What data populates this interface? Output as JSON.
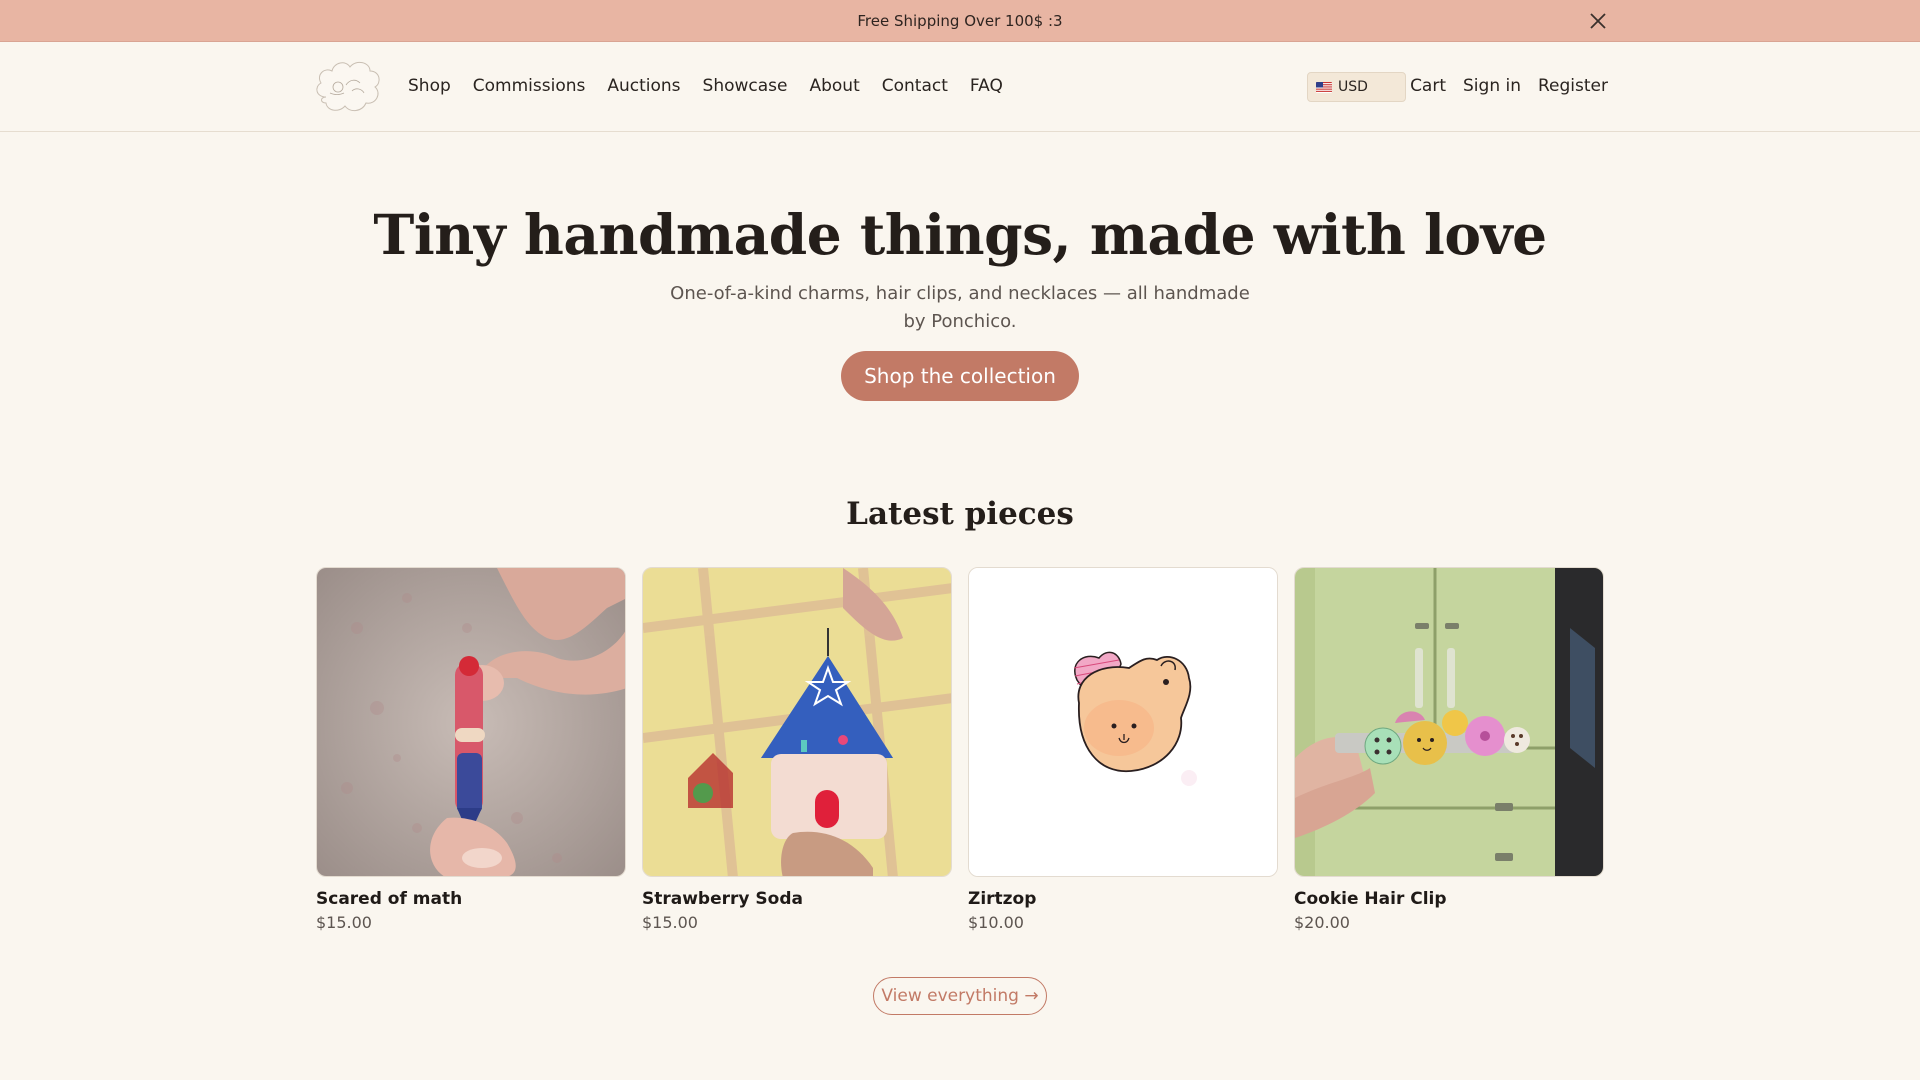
{
  "announcement": {
    "text": "Free Shipping Over 100$ :3",
    "close_icon": "close-icon"
  },
  "header": {
    "logo_icon": "cloud-logo-icon",
    "nav": [
      {
        "label": "Shop"
      },
      {
        "label": "Commissions"
      },
      {
        "label": "Auctions"
      },
      {
        "label": "Showcase"
      },
      {
        "label": "About"
      },
      {
        "label": "Contact"
      },
      {
        "label": "FAQ"
      }
    ],
    "currency": {
      "label": "USD",
      "flag_icon": "us-flag-icon"
    },
    "right_links": {
      "cart": "Cart",
      "sign_in": "Sign in",
      "register": "Register"
    }
  },
  "hero": {
    "title": "Tiny handmade things, made with love",
    "subtitle": "One-of-a-kind charms, hair clips, and necklaces — all handmade by Ponchico.",
    "cta": "Shop the collection"
  },
  "latest": {
    "title": "Latest pieces",
    "products": [
      {
        "name": "Scared of math",
        "price": "$15.00",
        "image_icon": "pencil-charm-photo"
      },
      {
        "name": "Strawberry Soda",
        "price": "$15.00",
        "image_icon": "house-charm-photo"
      },
      {
        "name": "Zirtzop",
        "price": "$10.00",
        "image_icon": "bear-drawing-image"
      },
      {
        "name": "Cookie Hair Clip",
        "price": "$20.00",
        "image_icon": "cookie-clip-photo"
      }
    ],
    "view_all": "View everything →"
  },
  "colors": {
    "background": "#faf6ef",
    "announcement": "#e8b5a3",
    "accent": "#c27a66"
  }
}
